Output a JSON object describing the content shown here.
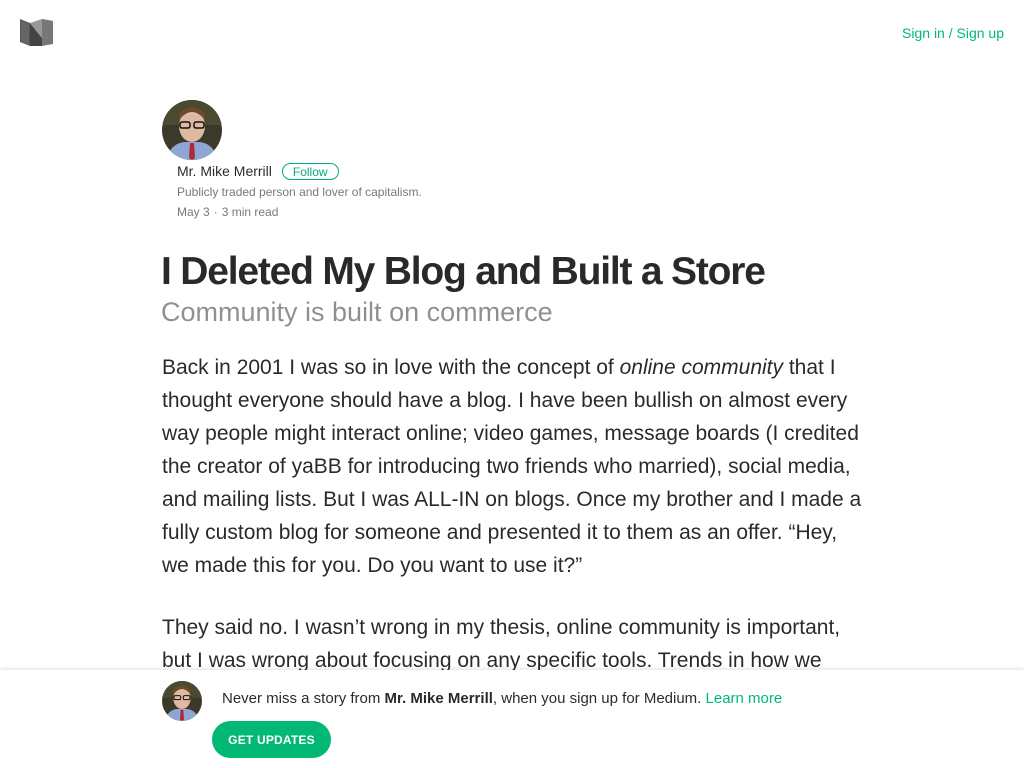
{
  "header": {
    "logo_icon": "medium-logo-icon",
    "signin_label": "Sign in / Sign up"
  },
  "author": {
    "name": "Mr. Mike Merrill",
    "follow_label": "Follow",
    "bio": "Publicly traded person and lover of capitalism.",
    "date": "May 3",
    "separator": "·",
    "read_time": "3 min read"
  },
  "article": {
    "title": "I Deleted My Blog and Built a Store",
    "subtitle": "Community is built on commerce",
    "p1_before": "Back in 2001 I was so in love with the concept of ",
    "p1_em": "online community",
    "p1_after": " that I thought everyone should have a blog. I have been bullish on almost every way people might interact online; video games, message boards (I credited the creator of yaBB for introducing two friends who married), social media, and mailing lists. But I was ALL-IN on blogs. Once my brother and I made a fully custom blog for someone and presented it to them as an offer. “Hey, we made this for you. Do you want to use it?”",
    "p2": "They said no. I wasn’t wrong in my thesis, online community is important, but I was wrong about focusing on any specific tools. Trends in how we"
  },
  "banner": {
    "text_before": "Never miss a story from ",
    "author": "Mr. Mike Merrill",
    "text_after": ", when you sign up for Medium. ",
    "learn_more": "Learn more",
    "button_label": "GET UPDATES"
  },
  "colors": {
    "accent": "#02b875",
    "follow": "#03a87c"
  }
}
